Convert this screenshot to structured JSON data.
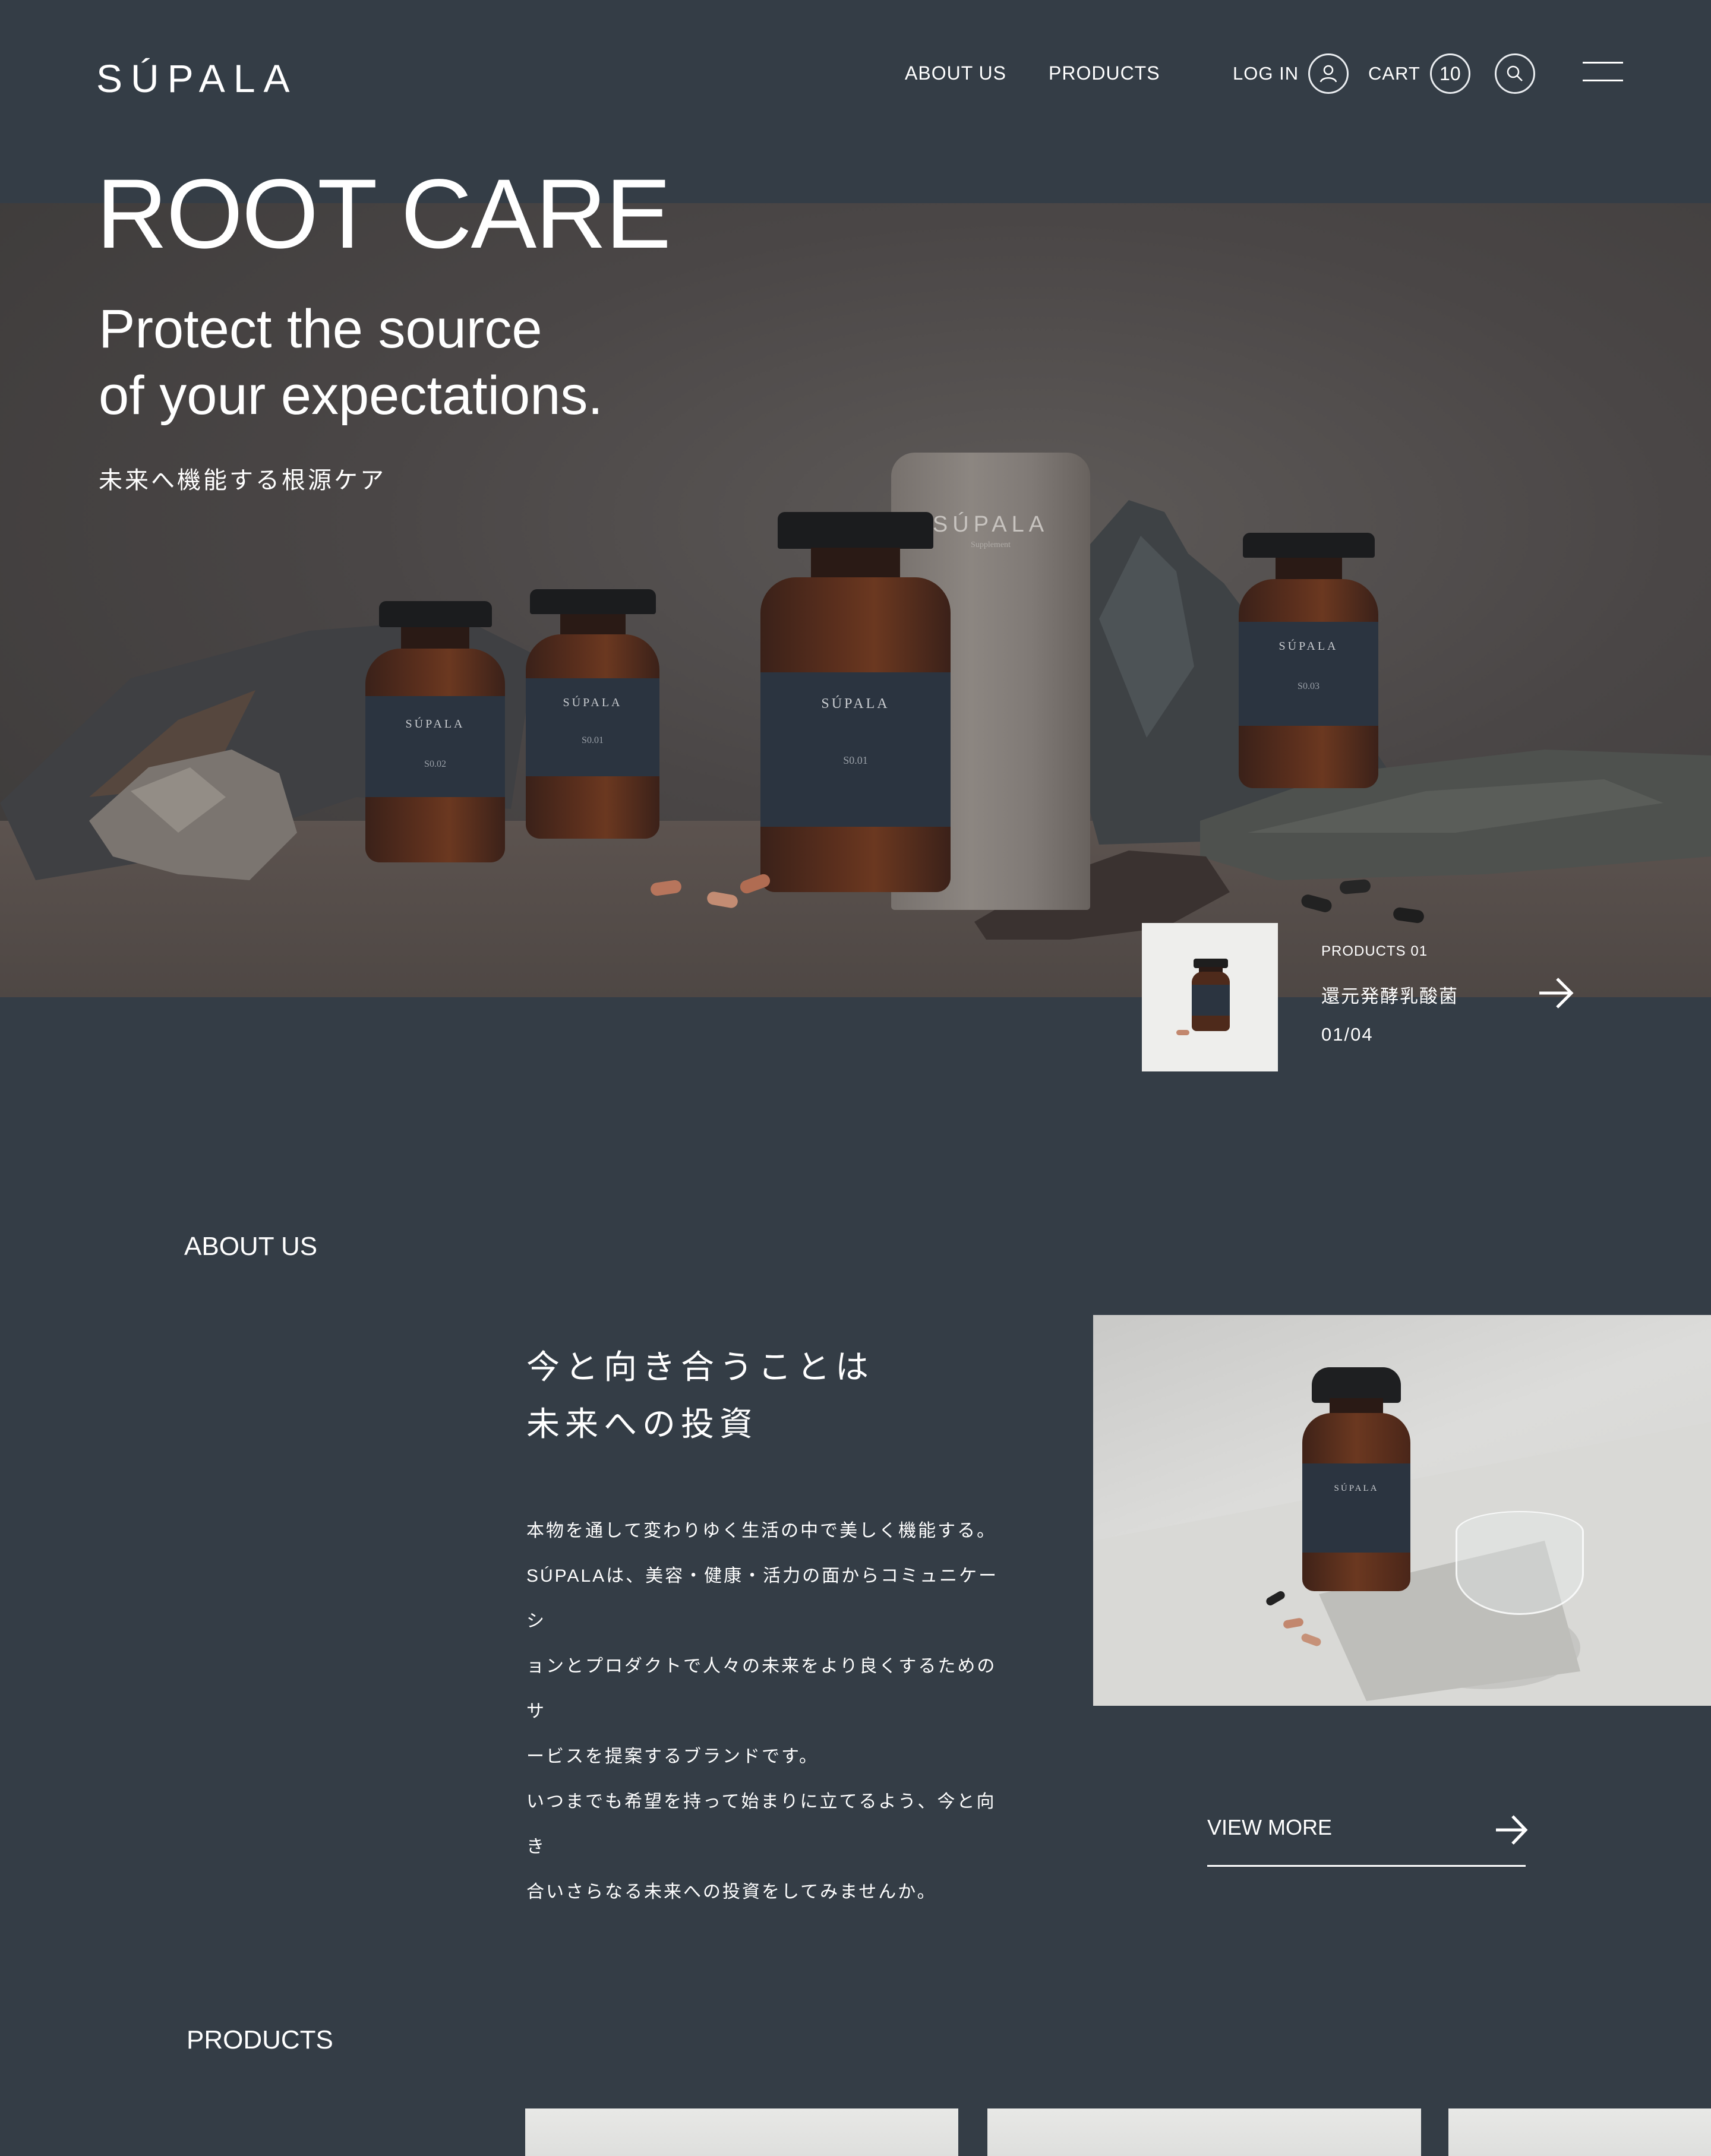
{
  "brand": "SÚPALA",
  "nav": {
    "about": "ABOUT US",
    "products": "PRODUCTS",
    "login": "LOG IN",
    "cart": "CART",
    "cart_count": "10"
  },
  "hero": {
    "title": "ROOT CARE",
    "subtitle_line1": "Protect the source",
    "subtitle_line2": "of your expectations.",
    "tagline_jp": "未来へ機能する根源ケア",
    "tube_brand": "SÚPALA",
    "tube_sub": "Supplement",
    "bottles": [
      {
        "brand": "SÚPALA",
        "code": "S0.02"
      },
      {
        "brand": "SÚPALA",
        "code": "S0.01"
      },
      {
        "brand": "SÚPALA",
        "code": "S0.01"
      },
      {
        "brand": "SÚPALA",
        "code": "S0.03"
      }
    ]
  },
  "slider": {
    "eyebrow": "PRODUCTS 01",
    "name": "還元発酵乳酸菌",
    "counter": "01/04"
  },
  "about": {
    "heading": "ABOUT US",
    "title_line1": "今と向き合うことは",
    "title_line2": "未来への投資",
    "body_lines": [
      "本物を通して変わりゆく生活の中で美しく機能する。",
      "SÚPALAは、美容・健康・活力の面からコミュニケーシ",
      "ョンとプロダクトで人々の未来をより良くするためのサ",
      "ービスを提案するブランドです。",
      "いつまでも希望を持って始まりに立てるよう、今と向き",
      "合いさらなる未来への投資をしてみませんか。"
    ],
    "image_bottle_brand": "SÚPALA",
    "view_more": "VIEW MORE"
  },
  "products": {
    "heading": "PRODUCTS"
  },
  "colors": {
    "background": "#343d46",
    "text": "#ffffff",
    "label_navy": "#2b3440",
    "amber": "#5b2f1d"
  },
  "icons": [
    "user-icon",
    "search-icon",
    "menu-icon",
    "arrow-right-icon"
  ]
}
